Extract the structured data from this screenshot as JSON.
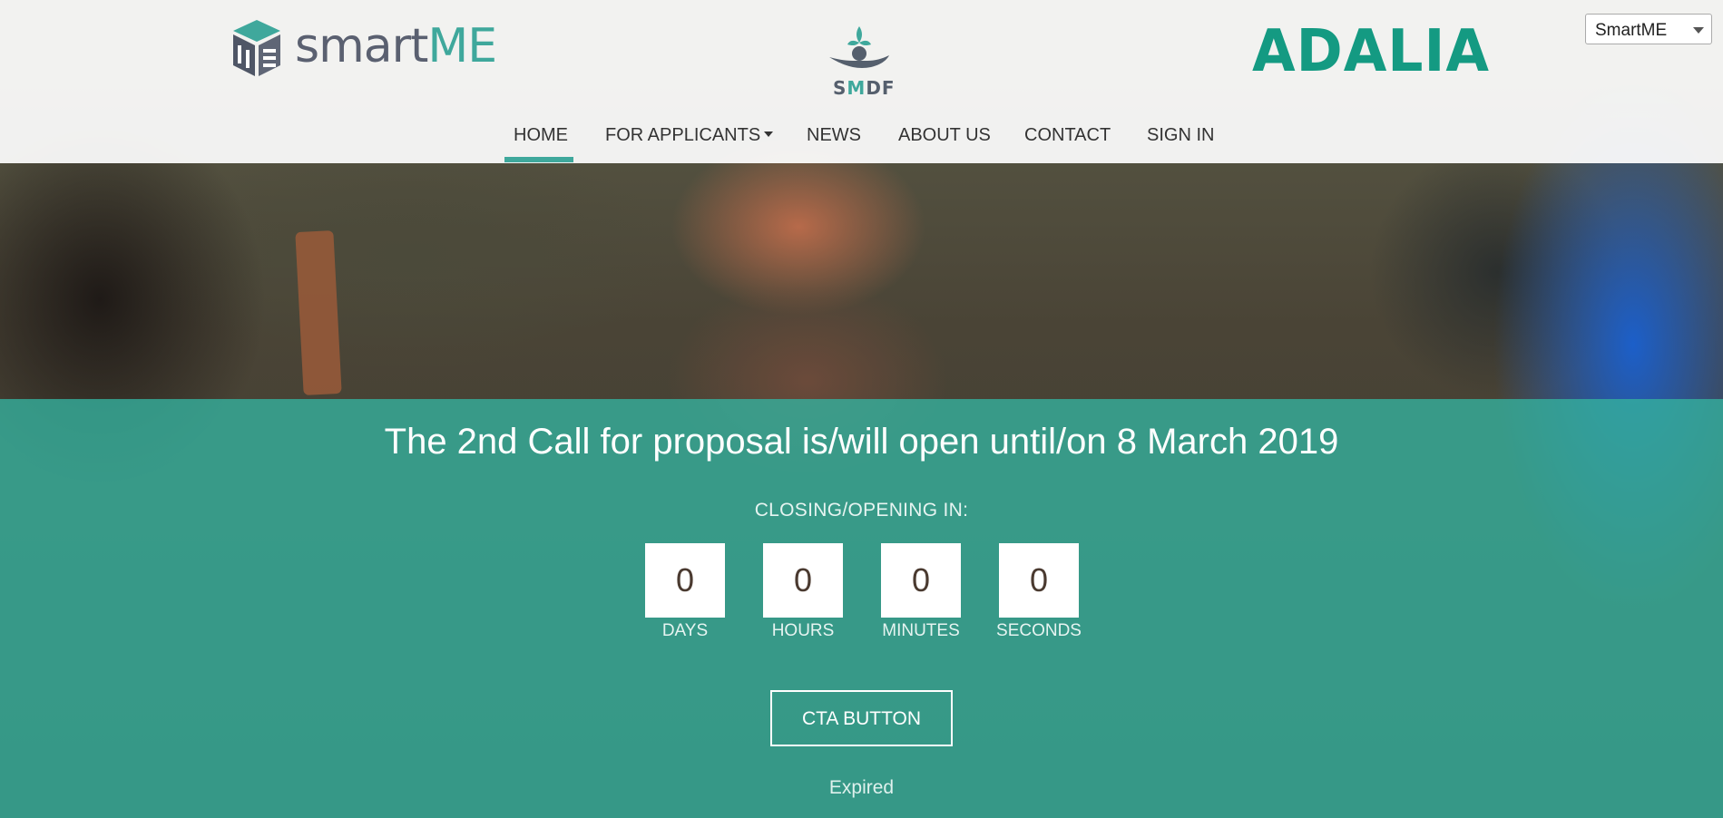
{
  "header": {
    "logos": {
      "smartme": {
        "prefix": "smart",
        "suffix": "ME"
      },
      "smdf": {
        "prefix": "S",
        "accent": "M",
        "suffix": "DF"
      },
      "adalia": {
        "text": "ADALIA"
      }
    },
    "language_select": {
      "value": "SmartME"
    }
  },
  "nav": {
    "items": [
      {
        "label": "HOME",
        "active": true
      },
      {
        "label": "FOR APPLICANTS",
        "has_dropdown": true
      },
      {
        "label": "NEWS"
      },
      {
        "label": "ABOUT US"
      },
      {
        "label": "CONTACT"
      },
      {
        "label": "SIGN IN"
      }
    ]
  },
  "hero": {
    "headline": "The 2nd Call for proposal is/will open until/on 8 March 2019",
    "countdown_title": "CLOSING/OPENING IN:",
    "countdown": [
      {
        "value": "0",
        "label": "DAYS"
      },
      {
        "value": "0",
        "label": "HOURS"
      },
      {
        "value": "0",
        "label": "MINUTES"
      },
      {
        "value": "0",
        "label": "SECONDS"
      }
    ],
    "cta_label": "CTA BUTTON",
    "status": "Expired"
  },
  "colors": {
    "accent": "#3fa89c",
    "teal_overlay": "#34b09e",
    "adalia_green": "#149a82"
  }
}
